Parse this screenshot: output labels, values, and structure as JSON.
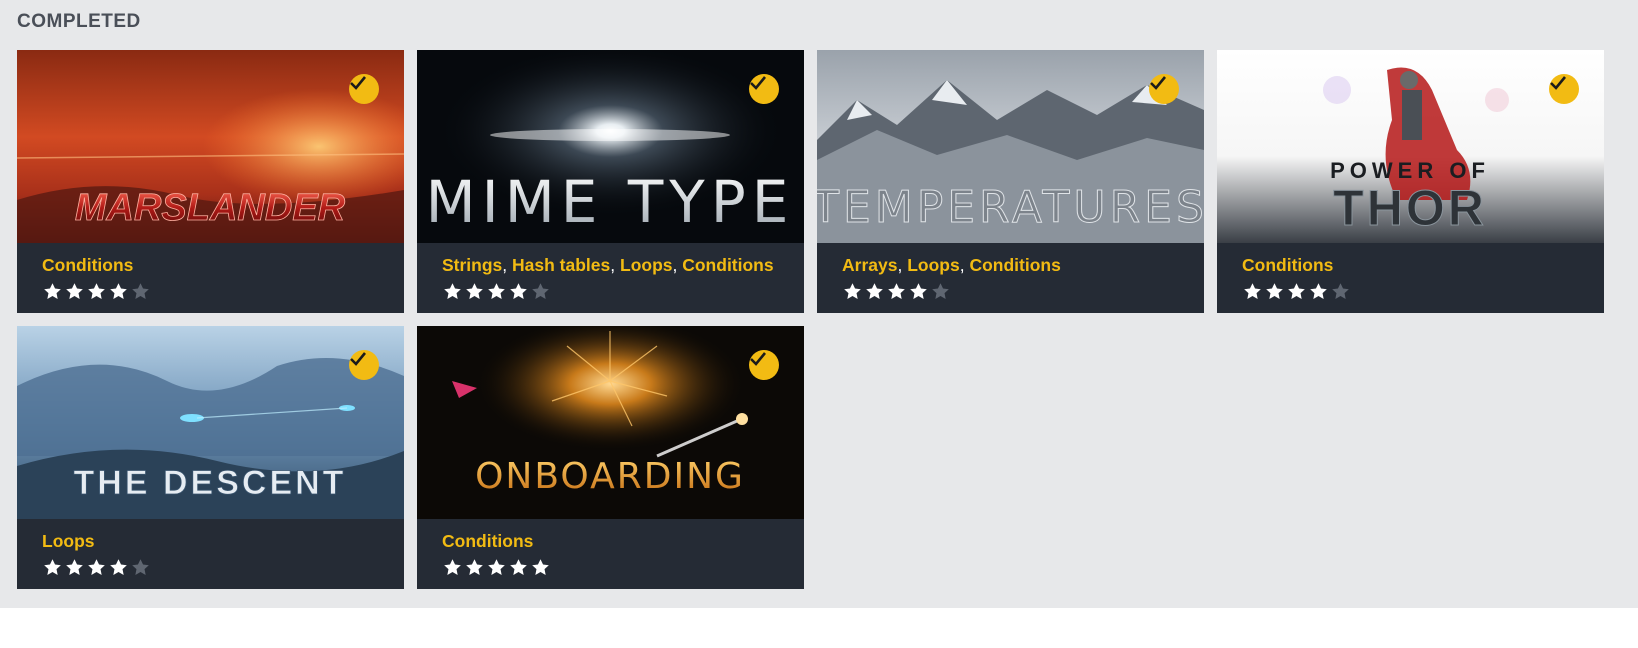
{
  "section": {
    "title": "COMPLETED"
  },
  "colors": {
    "accent": "#f2bb13",
    "card_bg": "#252b35",
    "panel_bg": "#e7e8ea",
    "star_on": "#ffffff",
    "star_off": "#5f6671"
  },
  "puzzles": [
    {
      "title": "MARSLANDER",
      "tags": [
        "Conditions"
      ],
      "rating": 4,
      "max_rating": 5,
      "completed": true,
      "icon": "check-icon"
    },
    {
      "title": "MIME TYPE",
      "tags": [
        "Strings",
        "Hash tables",
        "Loops",
        "Conditions"
      ],
      "rating": 4,
      "max_rating": 5,
      "completed": true,
      "icon": "check-icon"
    },
    {
      "title": "TEMPERATURES",
      "tags": [
        "Arrays",
        "Loops",
        "Conditions"
      ],
      "rating": 4,
      "max_rating": 5,
      "completed": true,
      "icon": "check-icon"
    },
    {
      "title_top": "POWER OF",
      "title": "THOR",
      "tags": [
        "Conditions"
      ],
      "rating": 4,
      "max_rating": 5,
      "completed": true,
      "icon": "check-icon"
    },
    {
      "title": "THE DESCENT",
      "tags": [
        "Loops"
      ],
      "rating": 4,
      "max_rating": 5,
      "completed": true,
      "icon": "check-icon"
    },
    {
      "title": "ONBOARDING",
      "tags": [
        "Conditions"
      ],
      "rating": 5,
      "max_rating": 5,
      "completed": true,
      "icon": "check-icon"
    }
  ]
}
